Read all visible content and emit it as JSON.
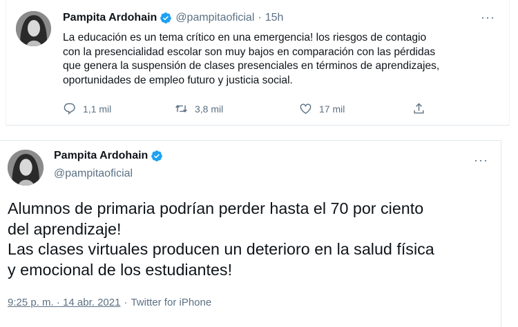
{
  "tweet1": {
    "author_name": "Pampita Ardohain",
    "author_handle": "@pampitaoficial",
    "separator": "·",
    "time_ago": "15h",
    "more_label": "···",
    "text": "La educación es un tema crítico en una emergencia! los riesgos de contagio\ncon la presencialidad escolar son muy bajos en comparación con las pérdidas\nque genera la suspensión de clases presenciales en términos de aprendizajes,\noportunidades de empleo futuro y justicia social.",
    "actions": {
      "reply_icon": "reply-icon",
      "reply_count": "1,1 mil",
      "retweet_icon": "retweet-icon",
      "retweet_count": "3,8 mil",
      "like_icon": "heart-icon",
      "like_count": "17 mil",
      "share_icon": "share-icon"
    }
  },
  "tweet2": {
    "author_name": "Pampita Ardohain",
    "author_handle": "@pampitaoficial",
    "more_label": "···",
    "text": "Alumnos de primaria podrían perder hasta el 70 por ciento\ndel aprendizaje!\nLas clases virtuales producen un deterioro en la salud física\ny emocional de los estudiantes!",
    "time": "9:25 p. m.",
    "date": "14 abr. 2021",
    "separator": "·",
    "source": "Twitter for iPhone"
  },
  "colors": {
    "text_primary": "#0f1419",
    "text_secondary": "#5b7083",
    "verified_blue": "#1da1f2",
    "divider": "#e1e8ed"
  }
}
